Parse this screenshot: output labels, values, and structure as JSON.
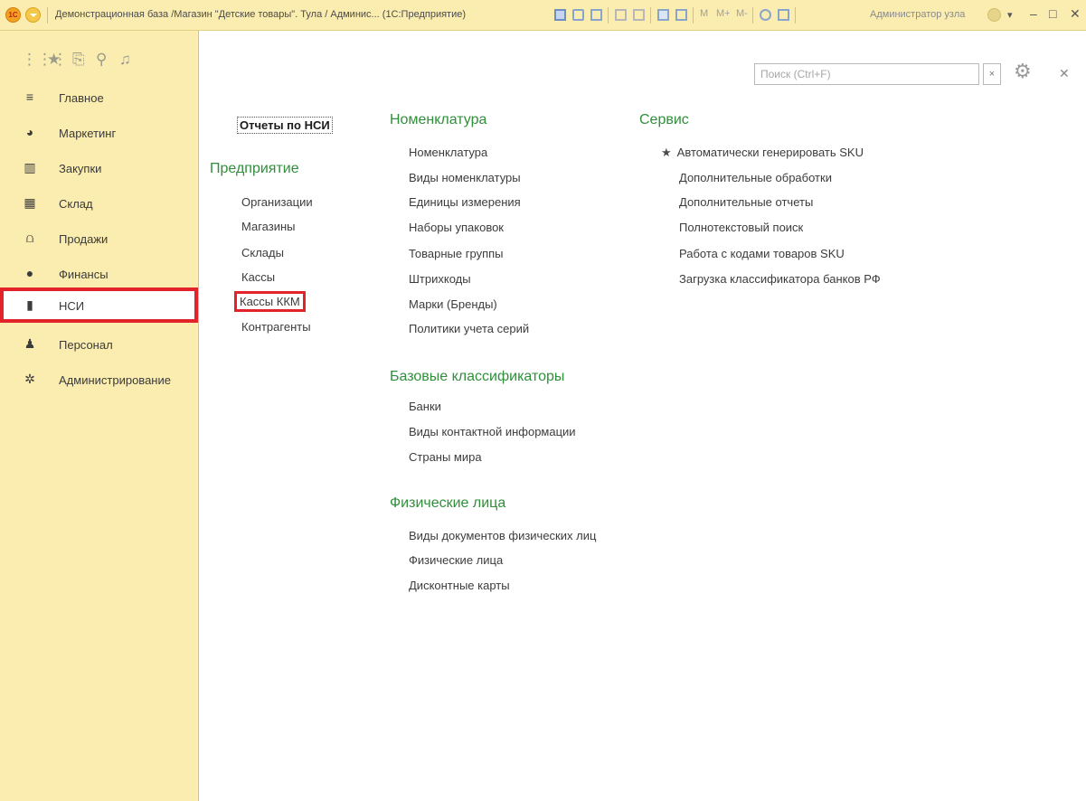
{
  "titlebar": {
    "logo_text": "1С",
    "title": "Демонстрационная база /Магазин \"Детские товары\". Тула / Админис... (1С:Предприятие)",
    "tools": [
      "M",
      "M+",
      "M-"
    ],
    "user": "Администратор узла"
  },
  "sidebar": {
    "items": [
      {
        "label": "Главное",
        "icon": "menu-lines-icon"
      },
      {
        "label": "Маркетинг",
        "icon": "pie-chart-icon"
      },
      {
        "label": "Закупки",
        "icon": "shopping-basket-icon"
      },
      {
        "label": "Склад",
        "icon": "warehouse-grid-icon"
      },
      {
        "label": "Продажи",
        "icon": "basket-icon"
      },
      {
        "label": "Финансы",
        "icon": "ruble-icon"
      },
      {
        "label": "НСИ",
        "icon": "documents-icon"
      },
      {
        "label": "Персонал",
        "icon": "person-icon"
      },
      {
        "label": "Администрирование",
        "icon": "gear-icon"
      }
    ],
    "active_index": 6
  },
  "toolbar": {
    "search_placeholder": "Поиск (Ctrl+F)",
    "search_value": ""
  },
  "columns": {
    "reports_link": "Отчеты по НСИ",
    "enterprise": {
      "title": "Предприятие",
      "items": [
        "Организации",
        "Магазины",
        "Склады",
        "Кассы",
        "Кассы ККМ",
        "Контрагенты"
      ]
    },
    "nomenclature": {
      "title": "Номенклатура",
      "items": [
        "Номенклатура",
        "Виды номенклатуры",
        "Единицы измерения",
        "Наборы упаковок",
        "Товарные группы",
        "Штрихкоды",
        "Марки (Бренды)",
        "Политики учета серий"
      ]
    },
    "classifiers": {
      "title": "Базовые классификаторы",
      "items": [
        "Банки",
        "Виды контактной информации",
        "Страны мира"
      ]
    },
    "persons": {
      "title": "Физические лица",
      "items": [
        "Виды документов физических лиц",
        "Физические лица",
        "Дисконтные карты"
      ]
    },
    "service": {
      "title": "Сервис",
      "items": [
        "Автоматически генерировать SKU",
        "Дополнительные обработки",
        "Дополнительные отчеты",
        "Полнотекстовый поиск",
        "Работа с кодами товаров SKU",
        "Загрузка классификатора банков РФ"
      ]
    }
  },
  "colors": {
    "sidebar_bg": "#fbedb0",
    "section_green": "#2f8f3a",
    "highlight_red": "#e2232a"
  }
}
